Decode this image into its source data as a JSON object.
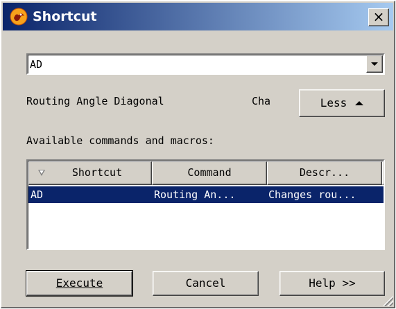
{
  "window": {
    "title": "Shortcut",
    "close_label": "×",
    "app_icon": "bird-logo-icon"
  },
  "search": {
    "value": "AD"
  },
  "selected_command": {
    "name": "Routing Angle Diagonal",
    "description_truncated": "Cha"
  },
  "toggle_button": {
    "label": "Less"
  },
  "list_label": "Available commands and macros:",
  "table": {
    "columns": [
      "Shortcut",
      "Command",
      "Descr..."
    ],
    "sorted_column_icon": "sort-descending-icon",
    "rows": [
      {
        "shortcut": "AD",
        "command": "Routing An...",
        "description": "Changes rou...",
        "selected": true
      }
    ]
  },
  "buttons": {
    "execute": "Execute",
    "cancel": "Cancel",
    "help": "Help >>"
  },
  "colors": {
    "title_bar_start": "#0a246a",
    "title_bar_end": "#a6caf0",
    "selection": "#0a246a",
    "face": "#d4d0c8"
  }
}
